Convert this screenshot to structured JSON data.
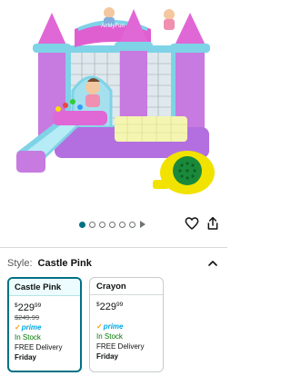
{
  "hero": {
    "image_name": "bounce-house-product-image",
    "brand_banner": "AirMyFun"
  },
  "carousel": {
    "total_images": 6,
    "active_index": 0,
    "has_video": true
  },
  "actions": {
    "save": "heart-icon",
    "share": "share-icon"
  },
  "style": {
    "label": "Style:",
    "value": "Castle Pink"
  },
  "options": [
    {
      "name": "Castle Pink",
      "price_symbol": "$",
      "price_whole": "229",
      "price_fraction": "99",
      "list_price": "$249.99",
      "prime": "prime",
      "stock": "In Stock",
      "delivery": "FREE Delivery",
      "delivery_day": "Friday",
      "selected": true
    },
    {
      "name": "Crayon",
      "price_symbol": "$",
      "price_whole": "229",
      "price_fraction": "99",
      "prime": "prime",
      "stock": "In Stock",
      "delivery": "FREE Delivery",
      "delivery_day": "Friday",
      "selected": false
    }
  ],
  "colors": {
    "accent": "#007185",
    "prime_blue": "#00a8e1",
    "in_stock_green": "#007600"
  }
}
